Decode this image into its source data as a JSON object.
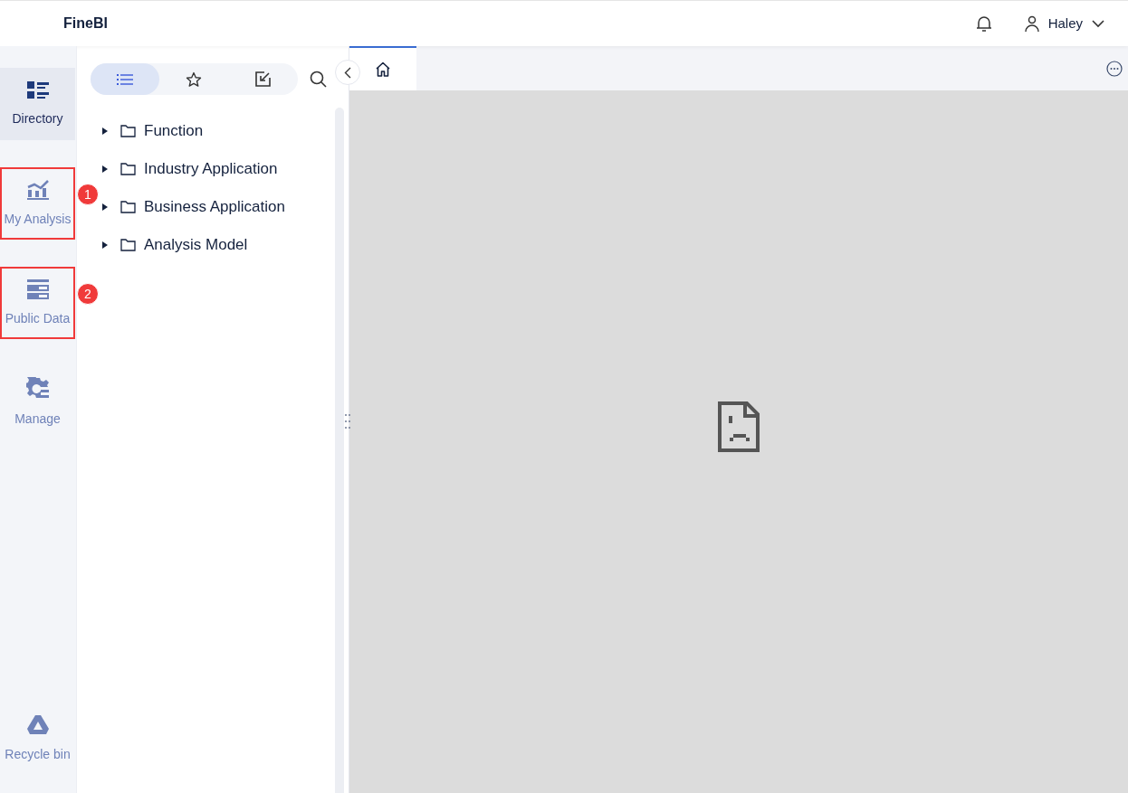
{
  "app": {
    "title": "FineBI"
  },
  "header": {
    "user": "Haley"
  },
  "nav": [
    {
      "label": "Directory",
      "kind": "directory",
      "selected": true,
      "highlighted": false
    },
    {
      "label": "My Analysis",
      "kind": "analysis",
      "selected": false,
      "highlighted": true,
      "callout": "1"
    },
    {
      "label": "Public Data",
      "kind": "data",
      "selected": false,
      "highlighted": true,
      "callout": "2"
    },
    {
      "label": "Manage",
      "kind": "manage",
      "selected": false,
      "highlighted": false
    },
    {
      "label": "Recycle bin",
      "kind": "recycle",
      "selected": false,
      "highlighted": false
    }
  ],
  "panel_tabs": [
    {
      "kind": "list",
      "selected": true
    },
    {
      "kind": "star",
      "selected": false
    },
    {
      "kind": "import",
      "selected": false
    }
  ],
  "tree": [
    {
      "label": "Function",
      "expanded": false
    },
    {
      "label": "Industry Application",
      "expanded": false
    },
    {
      "label": "Business Application",
      "expanded": false
    },
    {
      "label": "Analysis Model",
      "expanded": false
    }
  ],
  "tabs": [
    {
      "kind": "home",
      "selected": true
    }
  ]
}
